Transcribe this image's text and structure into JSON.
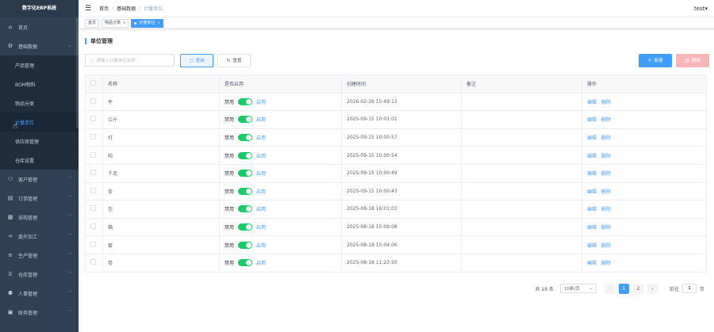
{
  "app": {
    "title": "数字化ERP系统"
  },
  "sidebar": {
    "items": [
      {
        "label": "首页",
        "icon": "home-icon",
        "glyph": "⌂"
      },
      {
        "label": "基础数据",
        "icon": "gear-icon",
        "glyph": "⚙"
      },
      {
        "label": "客户管理",
        "icon": "user-icon",
        "glyph": "⚇"
      },
      {
        "label": "订单管理",
        "icon": "document-icon",
        "glyph": "▤"
      },
      {
        "label": "采购管理",
        "icon": "cart-icon",
        "glyph": "▦"
      },
      {
        "label": "委外加工",
        "icon": "share-icon",
        "glyph": "⋖"
      },
      {
        "label": "生产管理",
        "icon": "list-icon",
        "glyph": "≡"
      },
      {
        "label": "仓库管理",
        "icon": "warehouse-icon",
        "glyph": "⌸"
      },
      {
        "label": "人事管理",
        "icon": "person-icon",
        "glyph": "⚉"
      },
      {
        "label": "财务管理",
        "icon": "finance-icon",
        "glyph": "▣"
      }
    ],
    "sub": [
      "产品管理",
      "BOM物料",
      "物品分类",
      "计量单位",
      "供应商管理",
      "仓库设置"
    ]
  },
  "navbar": {
    "breadcrumb": [
      "首页",
      "基础数据",
      "计量单位"
    ],
    "user": "test"
  },
  "tags": [
    "首页",
    "物品分类",
    "计量单位"
  ],
  "page": {
    "title": "单位管理"
  },
  "search": {
    "placeholder": "请输入计量单位名称"
  },
  "buttons": {
    "query": "查询",
    "reset": "重置",
    "add": "新增",
    "delete": "删除"
  },
  "table": {
    "headers": [
      "名称",
      "是否启用",
      "创建时间",
      "备注",
      "操作"
    ],
    "switch_off": "禁用",
    "switch_on": "启用",
    "op_edit": "编辑",
    "op_delete": "删除",
    "rows": [
      {
        "name": "件",
        "time": "2026-02-26 15:49:13"
      },
      {
        "name": "公斤",
        "time": "2025-09-15 10:01:01"
      },
      {
        "name": "打",
        "time": "2025-09-15 10:00:57"
      },
      {
        "name": "吨",
        "time": "2025-09-15 10:00:54"
      },
      {
        "name": "千克",
        "time": "2025-09-15 10:00:49"
      },
      {
        "name": "条",
        "time": "2025-09-15 10:00:43"
      },
      {
        "name": "包",
        "time": "2025-08-18 16:01:03"
      },
      {
        "name": "箱",
        "time": "2025-08-18 15:09:08"
      },
      {
        "name": "套",
        "time": "2025-08-18 15:04:06"
      },
      {
        "name": "卷",
        "time": "2025-08-18 11:23:50"
      }
    ]
  },
  "pagination": {
    "total": "共 18 条",
    "page_size": "10条/页",
    "pages": [
      "1",
      "2"
    ],
    "goto_label": "前往",
    "goto_value": "1",
    "goto_suffix": "页"
  },
  "colors": {
    "sidebar": "#304156",
    "accent": "#409eff",
    "switch": "#13ce66",
    "danger": "#fab6b6"
  }
}
